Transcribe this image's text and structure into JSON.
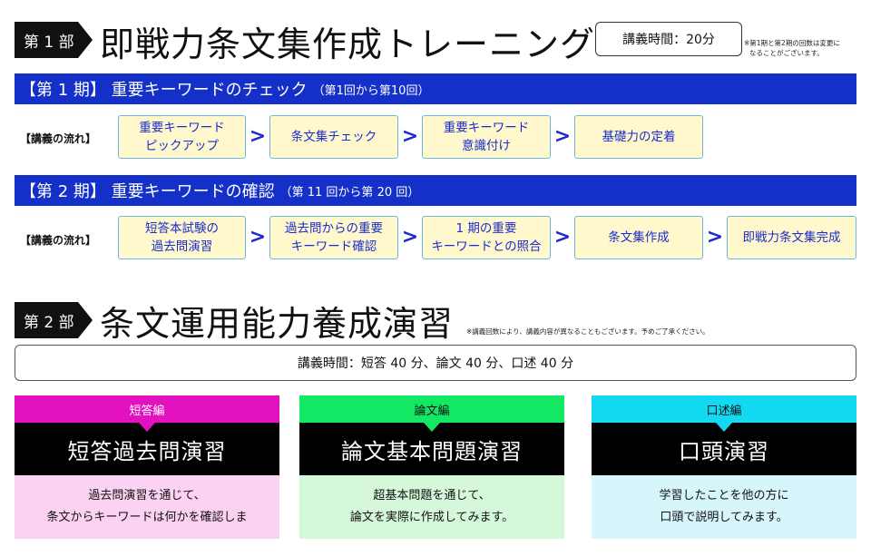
{
  "part1": {
    "tag": "第 1 部",
    "title": "即戦力条文集作成トレーニング",
    "time": "講義時間：20分",
    "note_line1": "※第1期と第2期の回数は変更に",
    "note_line2": "なることがございます。",
    "phase1": {
      "title": "【第 1 期】 重要キーワードのチェック",
      "subtitle": "（第1回から第10回）",
      "flow_label": "【講義の流れ】",
      "steps": [
        "重要キーワード\nピックアップ",
        "条文集チェック",
        "重要キーワード\n意識付け",
        "基礎力の定着"
      ]
    },
    "phase2": {
      "title": "【第 2 期】 重要キーワードの確認",
      "subtitle": "（第 11 回から第 20 回）",
      "flow_label": "【講義の流れ】",
      "steps": [
        "短答本試験の\n過去問演習",
        "過去問からの重要\nキーワード確認",
        "1 期の重要\nキーワードとの照合",
        "条文集作成",
        "即戦力条文集完成"
      ]
    }
  },
  "part2": {
    "tag": "第 2 部",
    "title": "条文運用能力養成演習",
    "note": "※講義回数により、講義内容が異なることもございます。予めご了承ください。",
    "time": "講義時間：短答 40 分、論文 40 分、口述 40 分",
    "columns": [
      {
        "head": "短答編",
        "title": "短答過去問演習",
        "desc": "過去問演習を通じて、\n条文からキーワードは何かを確認しま",
        "color": "#e312c0",
        "bg": "#fcd2f2"
      },
      {
        "head": "論文編",
        "title": "論文基本問題演習",
        "desc": "超基本問題を通じて、\n論文を実際に作成してみます。",
        "color": "#12e864",
        "bg": "#d6f8da"
      },
      {
        "head": "口述編",
        "title": "口頭演習",
        "desc": "学習したことを他の方に\n口頭で説明してみます。",
        "color": "#12d8f2",
        "bg": "#d6f6fc"
      }
    ]
  }
}
